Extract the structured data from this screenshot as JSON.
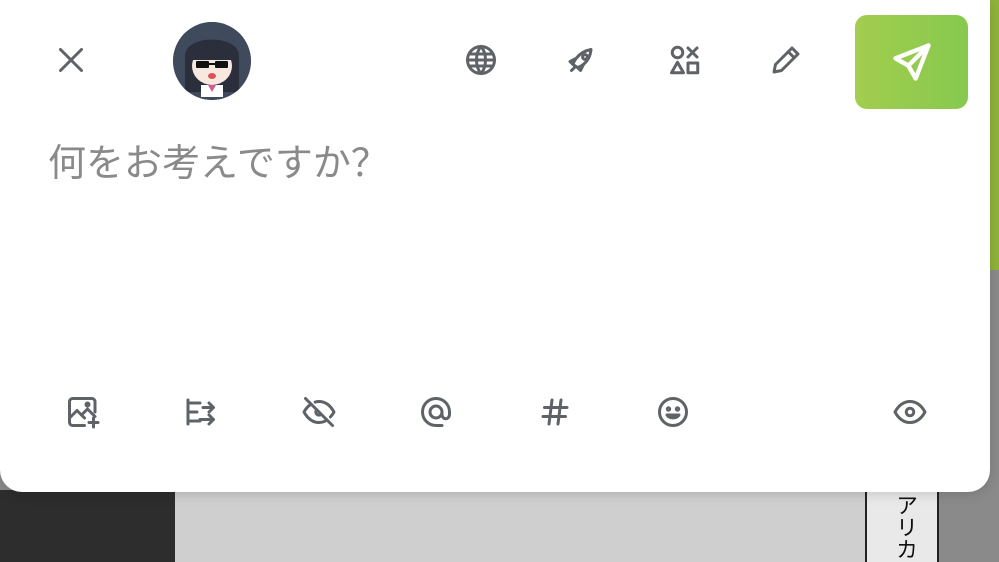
{
  "compose": {
    "placeholder": "何をお考えですか？"
  },
  "header": {
    "icons": [
      "close-icon",
      "globe-icon",
      "rocket-icon",
      "shapes-icon",
      "pencil-icon",
      "send-icon"
    ],
    "post_button_color": "#8ac94f"
  },
  "footer": {
    "icons": [
      "image-add-icon",
      "list-arrow-icon",
      "eye-off-icon",
      "at-icon",
      "hashtag-icon",
      "emoji-icon",
      "eye-icon"
    ]
  },
  "background": {
    "sign_text": "アリカ"
  }
}
